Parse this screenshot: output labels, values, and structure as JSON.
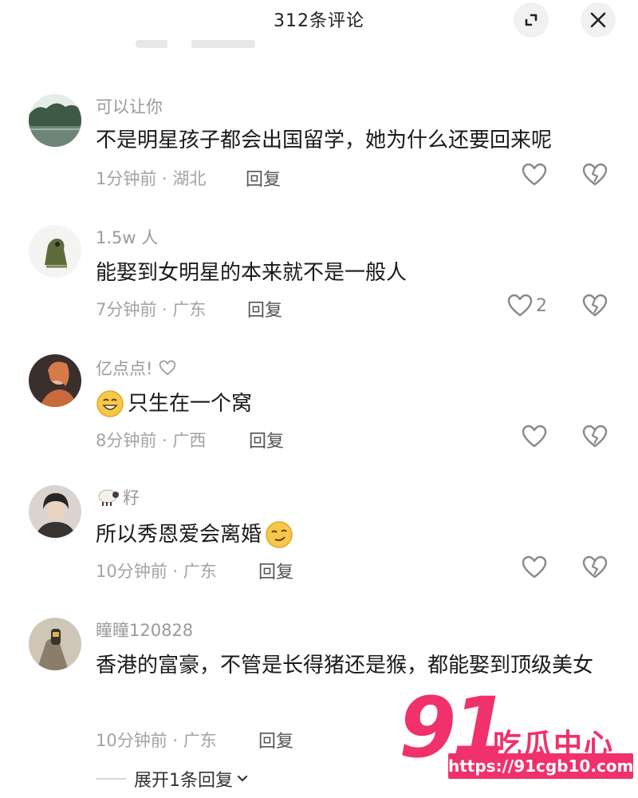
{
  "header": {
    "title": "312条评论"
  },
  "comments": [
    {
      "user": "可以让你",
      "text": "不是明星孩子都会出国留学，她为什么还要回来呢",
      "time_location": "1分钟前 · 湖北",
      "reply_label": "回复",
      "likes": ""
    },
    {
      "user": "1.5w 人",
      "text": "能娶到女明星的本来就不是一般人",
      "time_location": "7分钟前 · 广东",
      "reply_label": "回复",
      "likes": "2"
    },
    {
      "user": "亿点点!",
      "text": "只生在一个窝",
      "time_location": "8分钟前 · 广西",
      "reply_label": "回复",
      "likes": ""
    },
    {
      "user": "籽",
      "text": "所以秀恩爱会离婚",
      "time_location": "10分钟前 · 广东",
      "reply_label": "回复",
      "likes": ""
    },
    {
      "user": "瞳瞳120828",
      "text": "香港的富豪，不管是长得猪还是猴，都能娶到顶级美女",
      "time_location": "10分钟前 · 广东",
      "reply_label": "回复",
      "likes": ""
    }
  ],
  "expand_replies": {
    "label": "展开1条回复"
  },
  "watermark": {
    "number": "91",
    "text": "吃瓜中心",
    "url": "https://91cgb10.com"
  }
}
